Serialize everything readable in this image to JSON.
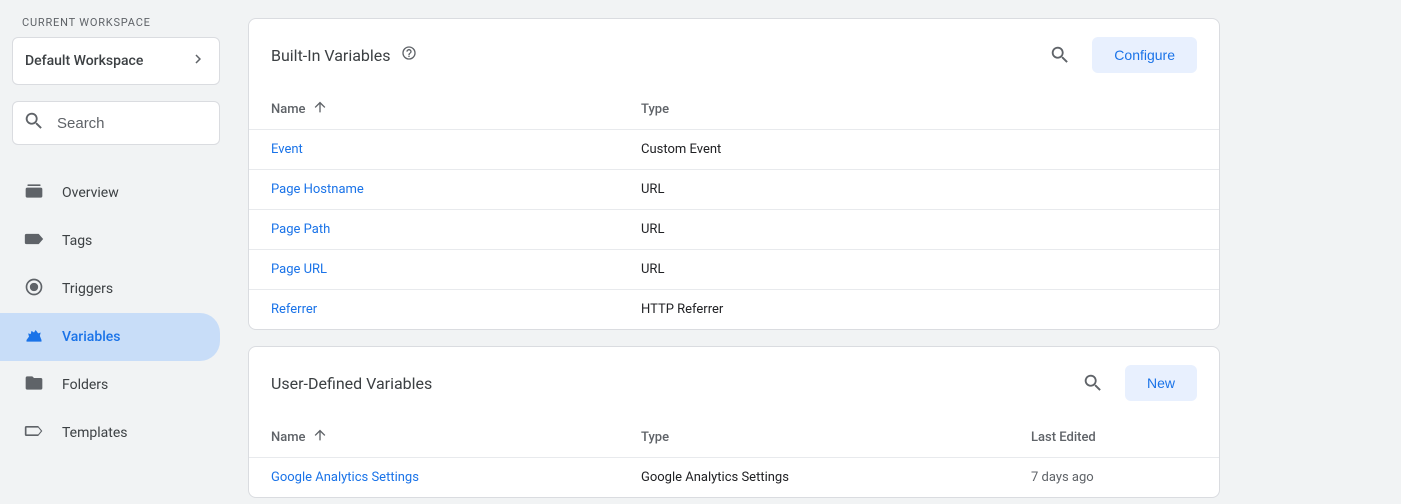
{
  "sidebar": {
    "workspace_label": "CURRENT WORKSPACE",
    "workspace_name": "Default Workspace",
    "search_placeholder": "Search",
    "nav": [
      {
        "key": "overview",
        "label": "Overview"
      },
      {
        "key": "tags",
        "label": "Tags"
      },
      {
        "key": "triggers",
        "label": "Triggers"
      },
      {
        "key": "variables",
        "label": "Variables"
      },
      {
        "key": "folders",
        "label": "Folders"
      },
      {
        "key": "templates",
        "label": "Templates"
      }
    ]
  },
  "builtin": {
    "title": "Built-In Variables",
    "action_label": "Configure",
    "columns": {
      "name": "Name",
      "type": "Type"
    },
    "rows": [
      {
        "name": "Event",
        "type": "Custom Event"
      },
      {
        "name": "Page Hostname",
        "type": "URL"
      },
      {
        "name": "Page Path",
        "type": "URL"
      },
      {
        "name": "Page URL",
        "type": "URL"
      },
      {
        "name": "Referrer",
        "type": "HTTP Referrer"
      }
    ]
  },
  "user": {
    "title": "User-Defined Variables",
    "action_label": "New",
    "columns": {
      "name": "Name",
      "type": "Type",
      "last_edited": "Last Edited"
    },
    "rows": [
      {
        "name": "Google Analytics Settings",
        "type": "Google Analytics Settings",
        "last_edited": "7 days ago"
      }
    ]
  }
}
